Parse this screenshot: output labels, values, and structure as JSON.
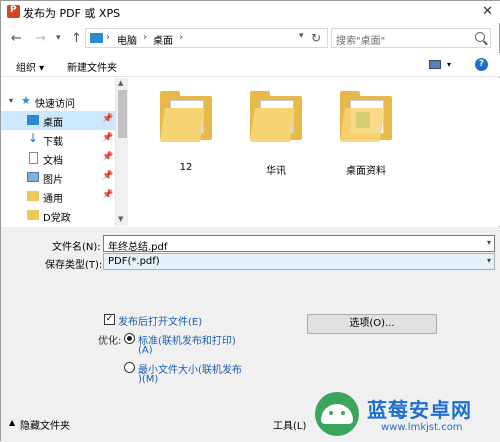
{
  "window": {
    "title": "发布为 PDF 或 XPS",
    "close_symbol": "✕"
  },
  "nav": {
    "back": "←",
    "forward": "→",
    "dropdown": "▾",
    "up": "↑",
    "refresh": "↻"
  },
  "address": {
    "crumbs": [
      "电脑",
      "桌面"
    ],
    "separator": "›"
  },
  "search": {
    "placeholder": "搜索\"桌面\""
  },
  "toolbar": {
    "organize": "组织 ▾",
    "new_folder": "新建文件夹",
    "view_dd": "▾",
    "help": "?"
  },
  "sidebar": {
    "quick_access": "快速访问",
    "items": [
      {
        "label": "桌面",
        "icon": "desktop-icon",
        "pinned": true,
        "selected": true
      },
      {
        "label": "下载",
        "icon": "download-icon",
        "pinned": true
      },
      {
        "label": "文档",
        "icon": "document-icon",
        "pinned": true
      },
      {
        "label": "图片",
        "icon": "pictures-icon",
        "pinned": true
      },
      {
        "label": "通用",
        "icon": "folder-icon",
        "pinned": true
      },
      {
        "label": "D党政",
        "icon": "folder-icon",
        "pinned": false
      }
    ],
    "pin_symbol": "📌"
  },
  "folders": [
    {
      "label": "12"
    },
    {
      "label": "华讯"
    },
    {
      "label": "桌面资料"
    }
  ],
  "form": {
    "filename_label": "文件名(N):",
    "filename_value": "年终总结.pdf",
    "filetype_label": "保存类型(T):",
    "filetype_value": "PDF(*.pdf)",
    "open_after_label": "发布后打开文件(E)",
    "open_after_checked": true,
    "optimize_label": "优化:",
    "opt_standard_line1": "标准(联机发布和打印)",
    "opt_standard_line2": "(A)",
    "opt_min_line1": "最小文件大小(联机发布",
    "opt_min_line2": ")(M)",
    "options_button": "选项(O)...",
    "hide_folders": "隐藏文件夹",
    "tools": "工具(L)"
  },
  "watermark": {
    "title": "蓝莓安卓网",
    "url": "www.lmkjst.com"
  }
}
